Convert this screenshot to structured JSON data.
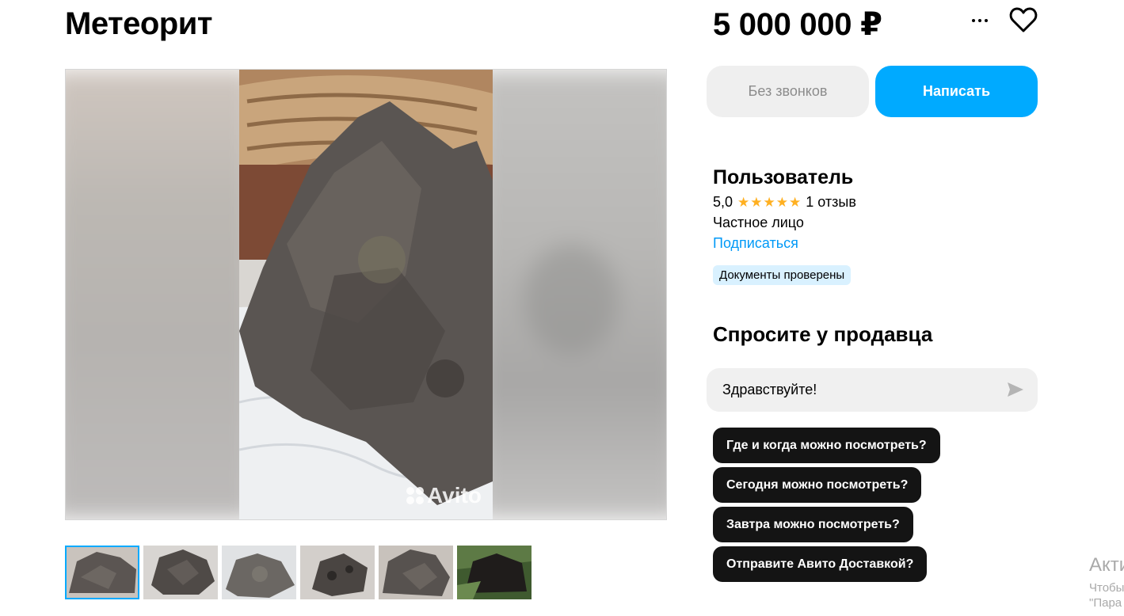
{
  "listing": {
    "title": "Метеорит",
    "price": "5 000 000 ₽"
  },
  "gallery": {
    "watermark": "Avito",
    "thumbnails_count": 6,
    "active_index": 0
  },
  "actions": {
    "no_calls_label": "Без звонков",
    "write_label": "Написать",
    "more_icon": "more-dots-icon",
    "favorite_icon": "heart-icon"
  },
  "seller": {
    "name": "Пользователь",
    "rating": "5,0",
    "stars": 5,
    "reviews": "1 отзыв",
    "type": "Частное лицо",
    "subscribe_label": "Подписаться",
    "badge": "Документы проверены"
  },
  "ask": {
    "title": "Спросите у продавца",
    "message_value": "Здравствуйте!",
    "send_icon": "send-icon",
    "quick_questions": [
      "Где и когда можно посмотреть?",
      "Сегодня можно посмотреть?",
      "Завтра можно посмотреть?",
      "Отправите Авито Доставкой?"
    ]
  },
  "os_overlay": {
    "line1": "Акти",
    "line2": "Чтобы",
    "line3": "\"Пара"
  },
  "colors": {
    "accent": "#00aaff",
    "link": "#0099f7",
    "star": "#ffb021",
    "badge_bg": "#d9f1ff",
    "dark_button": "#141414"
  }
}
